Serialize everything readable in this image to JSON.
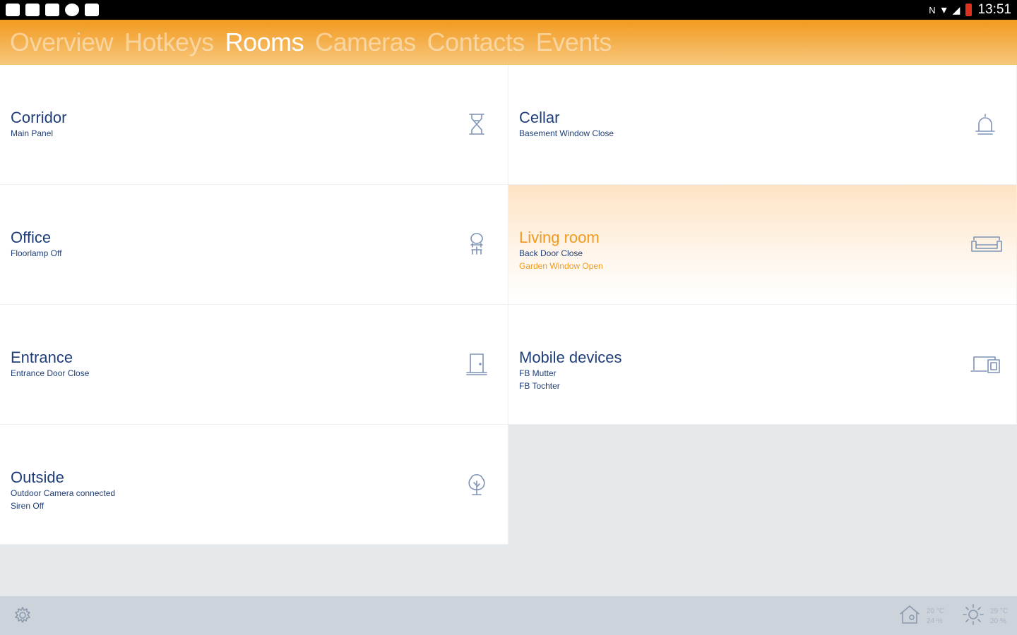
{
  "status_bar": {
    "left_icons": [
      "notification-icon",
      "notification-icon",
      "notification-icon",
      "circle-icon",
      "camera-icon"
    ],
    "right_icons": [
      "nfc-icon",
      "wifi-icon",
      "signal-icon",
      "battery-icon"
    ],
    "time": "13:51"
  },
  "tabs": [
    {
      "label": "Overview",
      "active": false
    },
    {
      "label": "Hotkeys",
      "active": false
    },
    {
      "label": "Rooms",
      "active": true
    },
    {
      "label": "Cameras",
      "active": false
    },
    {
      "label": "Contacts",
      "active": false
    },
    {
      "label": "Events",
      "active": false
    }
  ],
  "rooms": [
    {
      "name": "Corridor",
      "lines": [
        "Main Panel"
      ],
      "icon": "hourglass-icon"
    },
    {
      "name": "Cellar",
      "lines": [
        "Basement Window Close"
      ],
      "icon": "bell-icon"
    },
    {
      "name": "Office",
      "lines": [
        "Floorlamp Off"
      ],
      "icon": "office-chair-icon"
    },
    {
      "name": "Living room",
      "lines": [
        "Back Door Close",
        "Garden Window Open"
      ],
      "icon": "sofa-icon",
      "highlighted": true
    },
    {
      "name": "Entrance",
      "lines": [
        "Entrance Door Close"
      ],
      "icon": "door-icon"
    },
    {
      "name": "Mobile devices",
      "lines": [
        "FB Mutter",
        "FB Tochter"
      ],
      "icon": "devices-icon"
    },
    {
      "name": "Outside",
      "lines": [
        "Outdoor Camera connected",
        "Siren Off"
      ],
      "icon": "tree-icon"
    }
  ],
  "bottom_bar": {
    "settings_icon": "gear-icon",
    "indoor": {
      "icon": "house-icon",
      "temp": "20 °C",
      "humidity": "24 %"
    },
    "outdoor": {
      "icon": "sun-icon",
      "temp": "29 °C",
      "humidity": "20 %"
    }
  },
  "colors": {
    "accent": "#f29a1f",
    "text_primary": "#1f3e79",
    "icon_stroke": "#7e93b5",
    "background": "#e6e9ec"
  }
}
